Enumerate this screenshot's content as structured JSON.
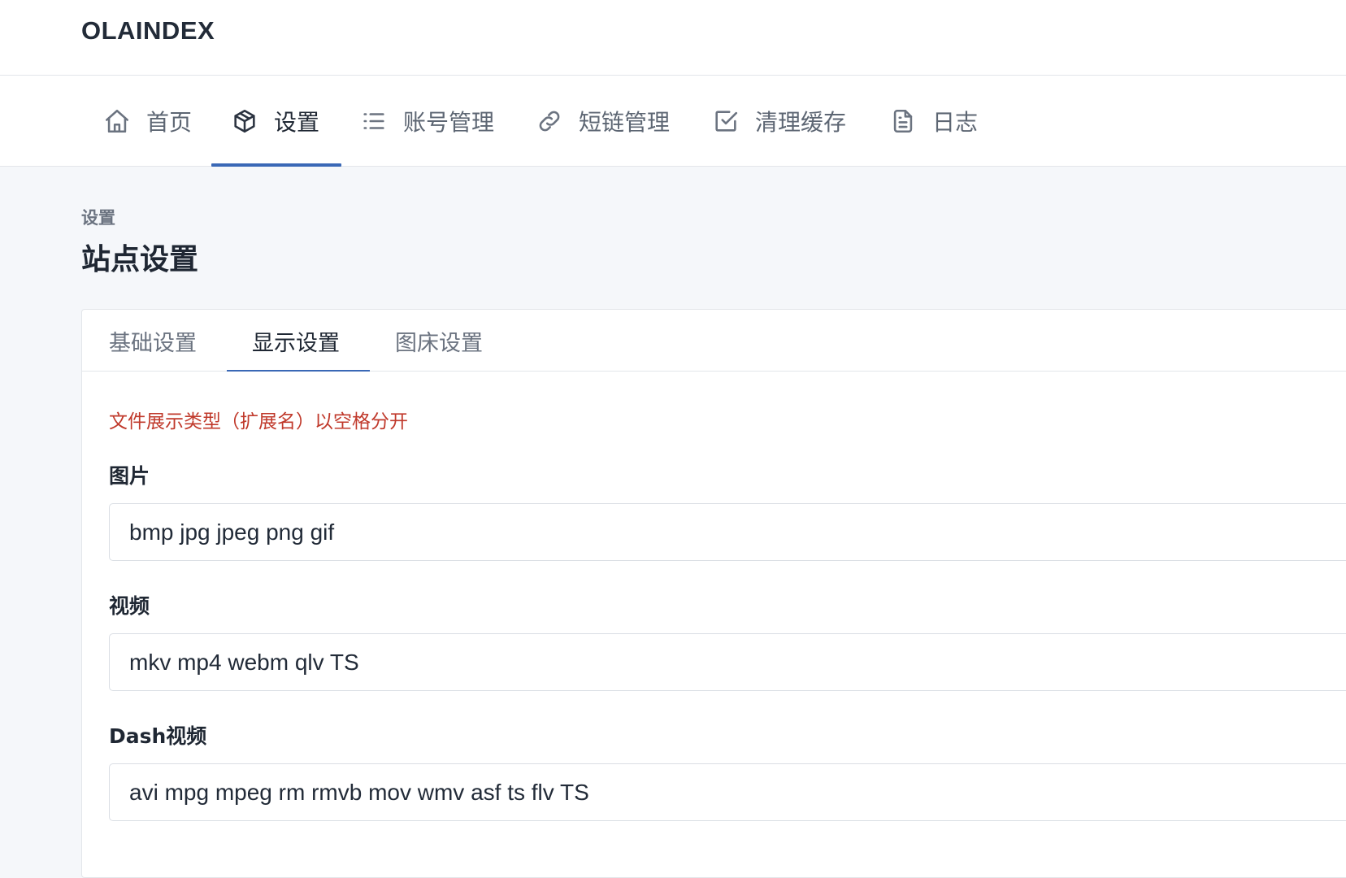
{
  "header": {
    "brand": "OLAINDEX"
  },
  "nav": {
    "items": [
      {
        "label": "首页",
        "icon": "home-icon"
      },
      {
        "label": "设置",
        "icon": "box-icon",
        "active": true
      },
      {
        "label": "账号管理",
        "icon": "list-icon"
      },
      {
        "label": "短链管理",
        "icon": "link-icon"
      },
      {
        "label": "清理缓存",
        "icon": "checkbox-icon"
      },
      {
        "label": "日志",
        "icon": "file-icon"
      }
    ]
  },
  "page": {
    "pretitle": "设置",
    "title": "站点设置"
  },
  "tabs": {
    "items": [
      {
        "label": "基础设置"
      },
      {
        "label": "显示设置",
        "active": true
      },
      {
        "label": "图床设置"
      }
    ]
  },
  "form": {
    "hint": "文件展示类型（扩展名）以空格分开",
    "fields": [
      {
        "label": "图片",
        "value": "bmp jpg jpeg png gif"
      },
      {
        "label": "视频",
        "value": "mkv mp4 webm qlv TS"
      },
      {
        "label": "Dash视频",
        "value": "avi mpg mpeg rm rmvb mov wmv asf ts flv TS"
      }
    ]
  },
  "colors": {
    "accent": "#3a68b6",
    "hint": "#c0392b",
    "background": "#f5f7fa"
  }
}
